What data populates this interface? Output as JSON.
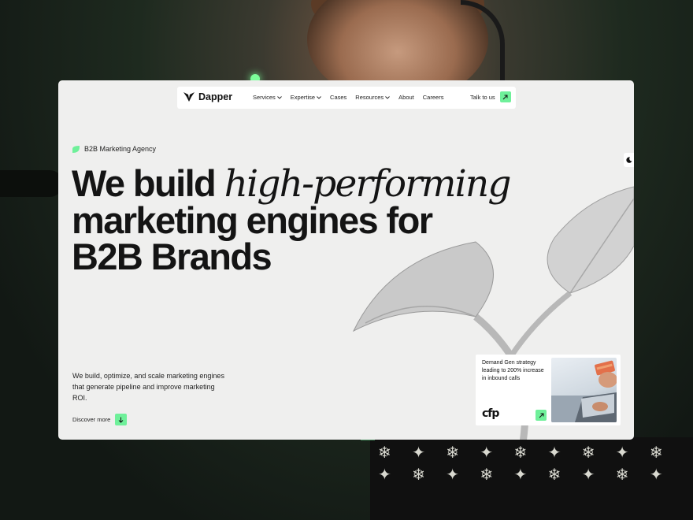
{
  "nav": {
    "logo": "Dapper",
    "items": [
      {
        "label": "Services",
        "dropdown": true
      },
      {
        "label": "Expertise",
        "dropdown": true
      },
      {
        "label": "Cases",
        "dropdown": false
      },
      {
        "label": "Resources",
        "dropdown": true
      },
      {
        "label": "About",
        "dropdown": false
      },
      {
        "label": "Careers",
        "dropdown": false
      }
    ],
    "cta": "Talk to us"
  },
  "hero": {
    "tag": "B2B Marketing Agency",
    "headline_part1": "We build ",
    "headline_italic": "high-performing",
    "headline_line2": "marketing engines for",
    "headline_line3": "B2B Brands",
    "subtext": "We build, optimize, and scale marketing engines that generate pipeline and improve marketing ROI.",
    "discover": "Discover more"
  },
  "case_card": {
    "text": "Demand Gen strategy leading to 200% increase in inbound calls",
    "logo": "cfp"
  },
  "colors": {
    "accent": "#6ff09a",
    "panel": "#efefee",
    "text": "#141414"
  },
  "icons": [
    "logo-mark-icon",
    "chevron-down-icon",
    "arrow-up-right-icon",
    "leaf-icon",
    "moon-icon",
    "arrow-down-icon"
  ]
}
